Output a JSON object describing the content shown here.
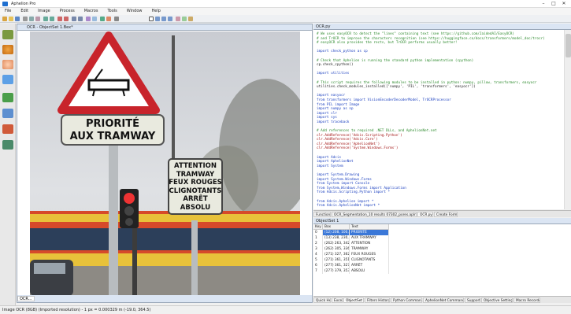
{
  "app": {
    "title": "Aphelion Pro"
  },
  "menu": [
    "File",
    "Edit",
    "Image",
    "Process",
    "Macros",
    "Tools",
    "Window",
    "Help"
  ],
  "document": {
    "title": "OCR - ObjectSet 1.Bex*",
    "footer_label": "OCR..."
  },
  "sign": {
    "line1": "PRIORITÉ",
    "line2": "AUX TRAMWAY",
    "small": [
      "ATTENTION",
      "TRAMWAY",
      "FEUX ROUGES",
      "CLIGNOTANTS",
      "ARRÊT",
      "ABSOLU"
    ]
  },
  "script_editor": {
    "title": "OCR.py",
    "lines": [
      {
        "t": "# We uses easyOCR to detect the \"lines\" containing text (see https://github.com/JaidedAI/EasyOCR)",
        "k": "cm"
      },
      {
        "t": "# and TrOCR to improve the characters recognition (see https://huggingface.co/docs/transformers/model_doc/trocr)",
        "k": "cm"
      },
      {
        "t": "# easyOCR also provides the rects, but TrOCR performs usually better!",
        "k": "cm"
      },
      {
        "t": "",
        "k": "nm"
      },
      {
        "t": "import check_python as cp",
        "k": "kw"
      },
      {
        "t": "",
        "k": "nm"
      },
      {
        "t": "# Check that Aphelion is running the standard python implementation (cpython)",
        "k": "cm"
      },
      {
        "t": "cp.check_cpython()",
        "k": "nm"
      },
      {
        "t": "",
        "k": "nm"
      },
      {
        "t": "import utilities",
        "k": "kw"
      },
      {
        "t": "",
        "k": "nm"
      },
      {
        "t": "# This script requires the following modules to be installed in python: numpy, pillow, transformers, easyocr",
        "k": "cm"
      },
      {
        "t": "utilities.check_modules_installed(['numpy', 'PIL', 'transformers', 'easyocr'])",
        "k": "nm"
      },
      {
        "t": "",
        "k": "nm"
      },
      {
        "t": "import easyocr",
        "k": "kw"
      },
      {
        "t": "from transformers import VisionEncoderDecoderModel, TrOCRProcessor",
        "k": "kw"
      },
      {
        "t": "from PIL import Image",
        "k": "kw"
      },
      {
        "t": "import numpy as np",
        "k": "kw"
      },
      {
        "t": "import clr",
        "k": "kw"
      },
      {
        "t": "import sys",
        "k": "kw"
      },
      {
        "t": "import traceback",
        "k": "kw"
      },
      {
        "t": "",
        "k": "nm"
      },
      {
        "t": "# Add references to required .NET DLLs, and AphelionNet.net",
        "k": "cm"
      },
      {
        "t": "clr.AddReference('Adcis.Scripting.Python')",
        "k": "st"
      },
      {
        "t": "clr.AddReference('Adcis.Core')",
        "k": "st"
      },
      {
        "t": "clr.AddReference('AphelionNet')",
        "k": "st"
      },
      {
        "t": "clr.AddReference('System.Windows.Forms')",
        "k": "st"
      },
      {
        "t": "",
        "k": "nm"
      },
      {
        "t": "import Adcis",
        "k": "kw"
      },
      {
        "t": "import AphelionNet",
        "k": "kw"
      },
      {
        "t": "import System",
        "k": "kw"
      },
      {
        "t": "",
        "k": "nm"
      },
      {
        "t": "import System.Drawing",
        "k": "kw"
      },
      {
        "t": "import System.Windows.Forms",
        "k": "kw"
      },
      {
        "t": "from System import Console",
        "k": "kw"
      },
      {
        "t": "from System.Windows.Forms import Application",
        "k": "kw"
      },
      {
        "t": "from Adcis.Scripting.Python import *",
        "k": "kw"
      },
      {
        "t": "",
        "k": "nm"
      },
      {
        "t": "from Adcis.Aphelion import *",
        "k": "kw"
      },
      {
        "t": "from Adcis.AphelionNet import *",
        "k": "kw"
      }
    ]
  },
  "tabs_top": [
    "Functions",
    "OCR_Segmentation_10 results 07302_pores.apln",
    "OCR.py",
    "Create Form.cs"
  ],
  "object_panel": {
    "title": "ObjectSet 1",
    "columns": [
      "Key",
      "Box",
      "Text"
    ],
    "rows": [
      {
        "key": "0",
        "box": "(12) 208, 100, 71",
        "text": "PRIORITÉ"
      },
      {
        "key": "1",
        "box": "(13) 238, 230, 30",
        "text": "AUX TRAMWAY"
      },
      {
        "key": "2",
        "box": "(262) 263, 342",
        "text": "ATTENTION"
      },
      {
        "key": "3",
        "box": "(262) 305, 336",
        "text": "TRAMWAY"
      },
      {
        "key": "4",
        "box": "(271) 327, 362",
        "text": "FEUX ROUGES"
      },
      {
        "key": "5",
        "box": "(271) 361, 351",
        "text": "CLIGNOTANTS"
      },
      {
        "key": "6",
        "box": "(277) 361, 327",
        "text": "ARRÊT"
      },
      {
        "key": "7",
        "box": "(277) 379, 353",
        "text": "ABSOLU"
      }
    ]
  },
  "tabs_bottom": [
    "Quick Help",
    "Excel",
    "ObjectSet 1",
    "Filters History",
    "Python Command",
    "AphelionNet Command",
    "Support",
    "Objective Settings",
    "Macro Recorder"
  ],
  "status": {
    "text": "Image OCR (8GB)   (Imported resolution) - 1 px = 0.000329 m  (-19.0, 364.5)"
  },
  "colors": {
    "accent": "#3b78d8",
    "panel_header": "#dbe5f3"
  }
}
